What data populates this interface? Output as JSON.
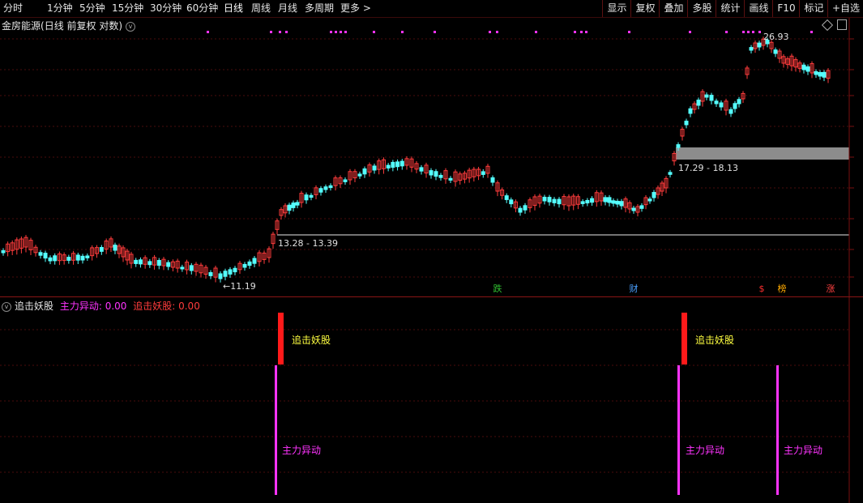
{
  "toolbar": {
    "tabs": [
      "分时",
      "1分钟",
      "5分钟",
      "15分钟",
      "30分钟",
      "60分钟",
      "日线",
      "周线",
      "月线",
      "多周期",
      "更多 >"
    ],
    "right_buttons": [
      "显示",
      "复权",
      "叠加",
      "多股",
      "统计",
      "画线",
      "F10",
      "标记",
      "+自选"
    ]
  },
  "chart_header": {
    "stock_name": "金房能源",
    "mode": "(日线 前复权 对数)"
  },
  "price_annotations": {
    "high_label": "26.93",
    "low_label": "←11.19",
    "zone1_label": "13.28 - 13.39",
    "zone2_label": "17.29 - 18.13"
  },
  "event_badges": [
    {
      "text": "跌",
      "color": "#30c030"
    },
    {
      "text": "财",
      "color": "#4aa0ff"
    },
    {
      "text": "$",
      "color": "#ff3030"
    },
    {
      "text": "榜",
      "color": "#ffaa00"
    },
    {
      "text": "涨",
      "color": "#ff4040"
    }
  ],
  "indicator_header": {
    "name": "追击妖股",
    "field1": "主力异动: 0.00",
    "field2": "追击妖股: 0.00"
  },
  "signal_labels": {
    "zhuiji": "追击妖股",
    "zhuli": "主力异动"
  },
  "colors": {
    "up": "#ff3c3c",
    "down": "#54ffff",
    "magenta": "#ff33ff",
    "yellow": "#ffff40",
    "grid": "#4a0d0d"
  }
}
